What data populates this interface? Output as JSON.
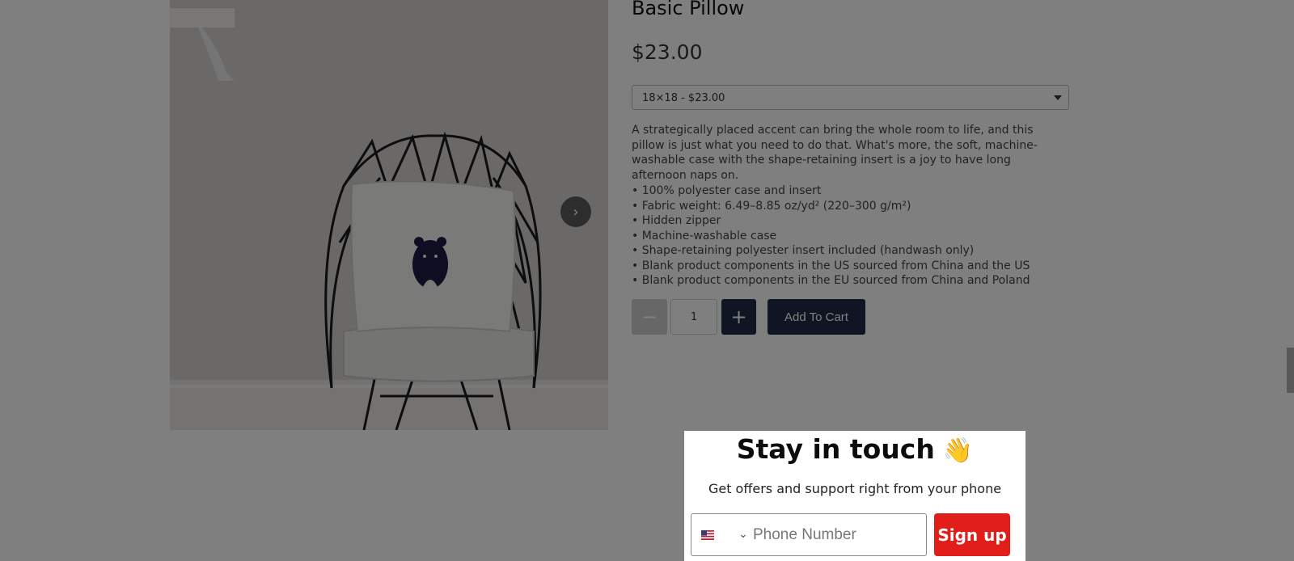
{
  "product": {
    "title": "Basic Pillow",
    "price": "$23.00",
    "variant_selected": "18×18 - $23.00",
    "description": "A strategically placed accent can bring the whole room to life, and this pillow is just what you need to do that. What's more, the soft, machine-washable case with the shape-retaining insert is a joy to have long afternoon naps on.",
    "features": [
      "100% polyester case and insert",
      "Fabric weight: 6.49–8.85 oz/yd² (220–300 g/m²)",
      "Hidden zipper",
      "Machine-washable case",
      "Shape-retaining polyester insert included (handwash only)",
      "Blank product components in the US sourced from China and the US",
      "Blank product components in the EU sourced from China and Poland"
    ],
    "quantity": "1",
    "minus_label": "−",
    "plus_label": "+",
    "add_to_cart_label": "Add To Cart"
  },
  "gallery": {
    "next_arrow_label": "›"
  },
  "popup": {
    "title": "Stay in touch",
    "wave_emoji": "👋",
    "subtitle": "Get offers and support right from your phone",
    "phone_placeholder": "Phone Number",
    "country_flag": "us-flag-icon",
    "signup_label": "Sign up",
    "signup_color": "#e21e1b"
  },
  "colors": {
    "button_dark": "#1f2b45",
    "overlay": "rgba(0,0,0,0.5)"
  }
}
